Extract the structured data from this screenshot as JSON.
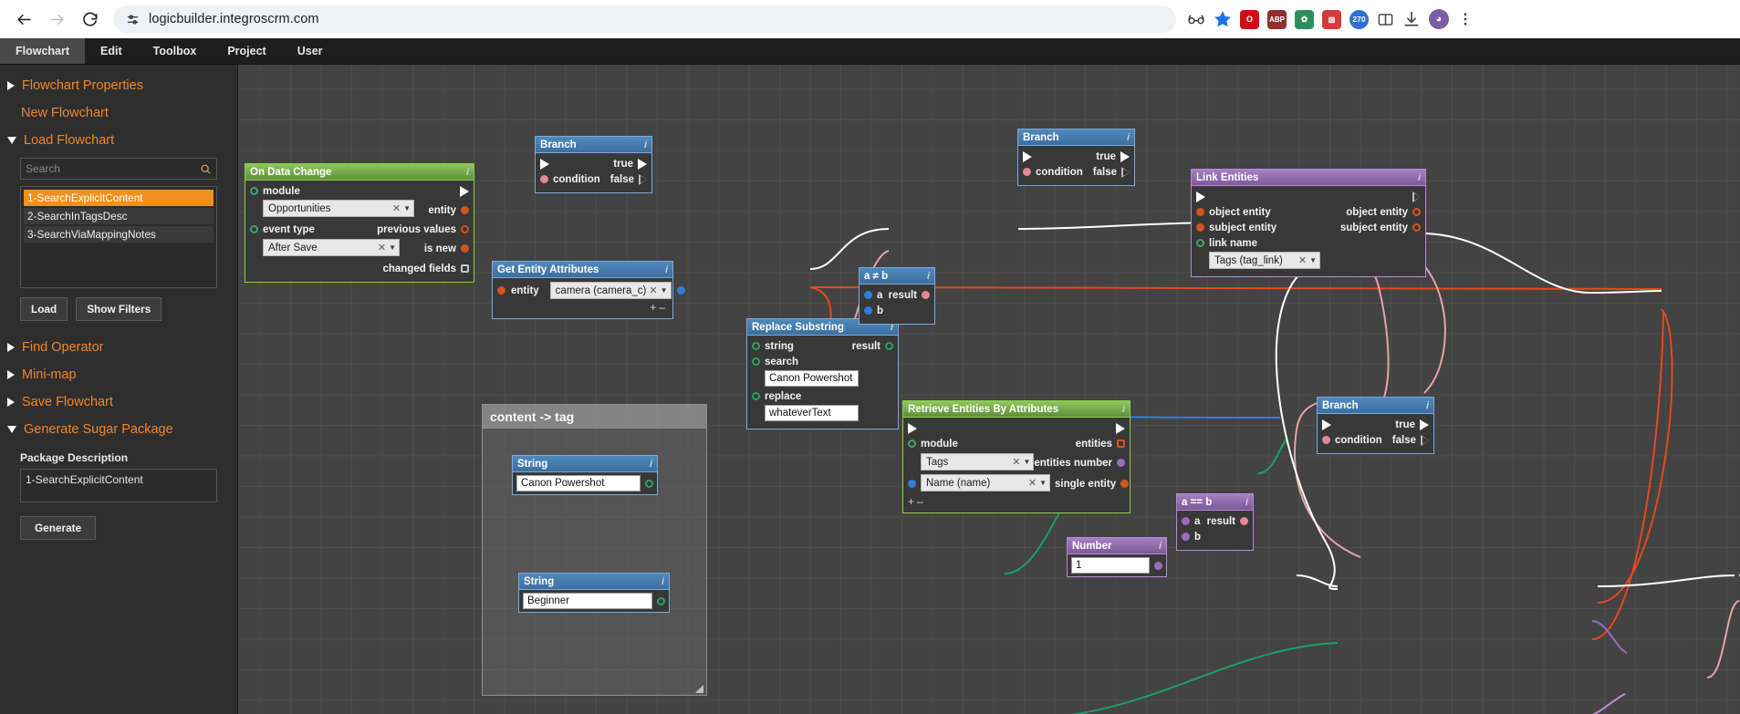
{
  "browser": {
    "url": "logicbuilder.integroscrm.com",
    "back_icon": "back-arrow-icon",
    "forward_icon": "forward-arrow-icon",
    "reload_icon": "reload-icon",
    "site_settings_icon": "site-settings-icon",
    "bookmark_icon": "star-icon",
    "extensions": [
      "opera-icon",
      "abp-icon",
      "chart-icon",
      "counter-badge",
      "split-screen-icon",
      "download-icon",
      "profile-avatar",
      "menu-icon"
    ],
    "counter_badge": "270"
  },
  "app_menu": {
    "items": [
      {
        "label": "Flowchart",
        "active": true
      },
      {
        "label": "Edit",
        "active": false
      },
      {
        "label": "Toolbox",
        "active": false
      },
      {
        "label": "Project",
        "active": false
      },
      {
        "label": "User",
        "active": false
      }
    ]
  },
  "sidebar": {
    "flowchart_properties": "Flowchart Properties",
    "new_flowchart": "New Flowchart",
    "load_flowchart": "Load Flowchart",
    "search_placeholder": "Search",
    "search_value": "",
    "flowcharts": [
      {
        "label": "1-SearchExplicitContent",
        "selected": true
      },
      {
        "label": "2-SearchInTagsDesc",
        "selected": false
      },
      {
        "label": "3-SearchViaMappingNotes",
        "selected": false
      }
    ],
    "load_button": "Load",
    "show_filters_button": "Show Filters",
    "find_operator": "Find Operator",
    "mini_map": "Mini-map",
    "save_flowchart": "Save Flowchart",
    "generate_sugar_package": "Generate Sugar Package",
    "package_description_label": "Package Description",
    "package_description_value": "1-SearchExplicitContent",
    "generate_button": "Generate"
  },
  "canvas": {
    "group": {
      "title": "content -> tag"
    },
    "nodes": {
      "on_data_change": {
        "title": "On Data Change",
        "info": "i",
        "module_label": "module",
        "module_value": "Opportunities",
        "event_type_label": "event type",
        "event_type_value": "After Save",
        "out_entity": "entity",
        "out_previous_values": "previous values",
        "out_is_new": "is new",
        "out_changed_fields": "changed fields"
      },
      "branch_1": {
        "title": "Branch",
        "info": "i",
        "condition": "condition",
        "true": "true",
        "false": "false"
      },
      "branch_2": {
        "title": "Branch",
        "info": "i",
        "condition": "condition",
        "true": "true",
        "false": "false"
      },
      "branch_3": {
        "title": "Branch",
        "info": "i",
        "condition": "condition",
        "true": "true",
        "false": "false"
      },
      "get_entity_attributes": {
        "title": "Get Entity Attributes",
        "info": "i",
        "entity_label": "entity",
        "entity_value": "camera (camera_c)",
        "plus": "+",
        "minus": "–"
      },
      "replace_substring": {
        "title": "Replace Substring",
        "info": "i",
        "string_label": "string",
        "result_label": "result",
        "search_label": "search",
        "search_value": "Canon Powershot",
        "replace_label": "replace",
        "replace_value": "whateverText"
      },
      "not_equal": {
        "title": "a ≠ b",
        "info": "i",
        "a": "a",
        "b": "b",
        "result": "result"
      },
      "equal": {
        "title": "a == b",
        "info": "i",
        "a": "a",
        "b": "b",
        "result": "result"
      },
      "string_1": {
        "title": "String",
        "info": "i",
        "value": "Canon Powershot"
      },
      "string_2": {
        "title": "String",
        "info": "i",
        "value": "Beginner"
      },
      "retrieve_entities": {
        "title": "Retrieve Entities By Attributes",
        "info": "i",
        "module_label": "module",
        "module_value": "Tags",
        "attribute_value": "Name (name)",
        "out_entities": "entities",
        "out_entities_number": "entities number",
        "out_single_entity": "single entity",
        "plus": "+",
        "minus": "–"
      },
      "number": {
        "title": "Number",
        "info": "i",
        "value": "1"
      },
      "link_entities": {
        "title": "Link Entities",
        "info": "i",
        "in_object_entity": "object entity",
        "in_subject_entity": "subject entity",
        "link_name_label": "link name",
        "link_name_value": "Tags (tag_link)",
        "out_object_entity": "object entity",
        "out_subject_entity": "subject entity"
      }
    }
  },
  "colors": {
    "accent_orange": "#f0862b",
    "select_orange": "#f0901e",
    "node_blue": "#7ea8d8",
    "node_green": "#8fce4a",
    "node_purple": "#b58ad4",
    "wire_white": "#ffffff",
    "wire_orange": "#e8481c",
    "wire_pink": "#e7a3ae",
    "wire_green": "#18a06a",
    "wire_blue": "#2f7fd8"
  }
}
